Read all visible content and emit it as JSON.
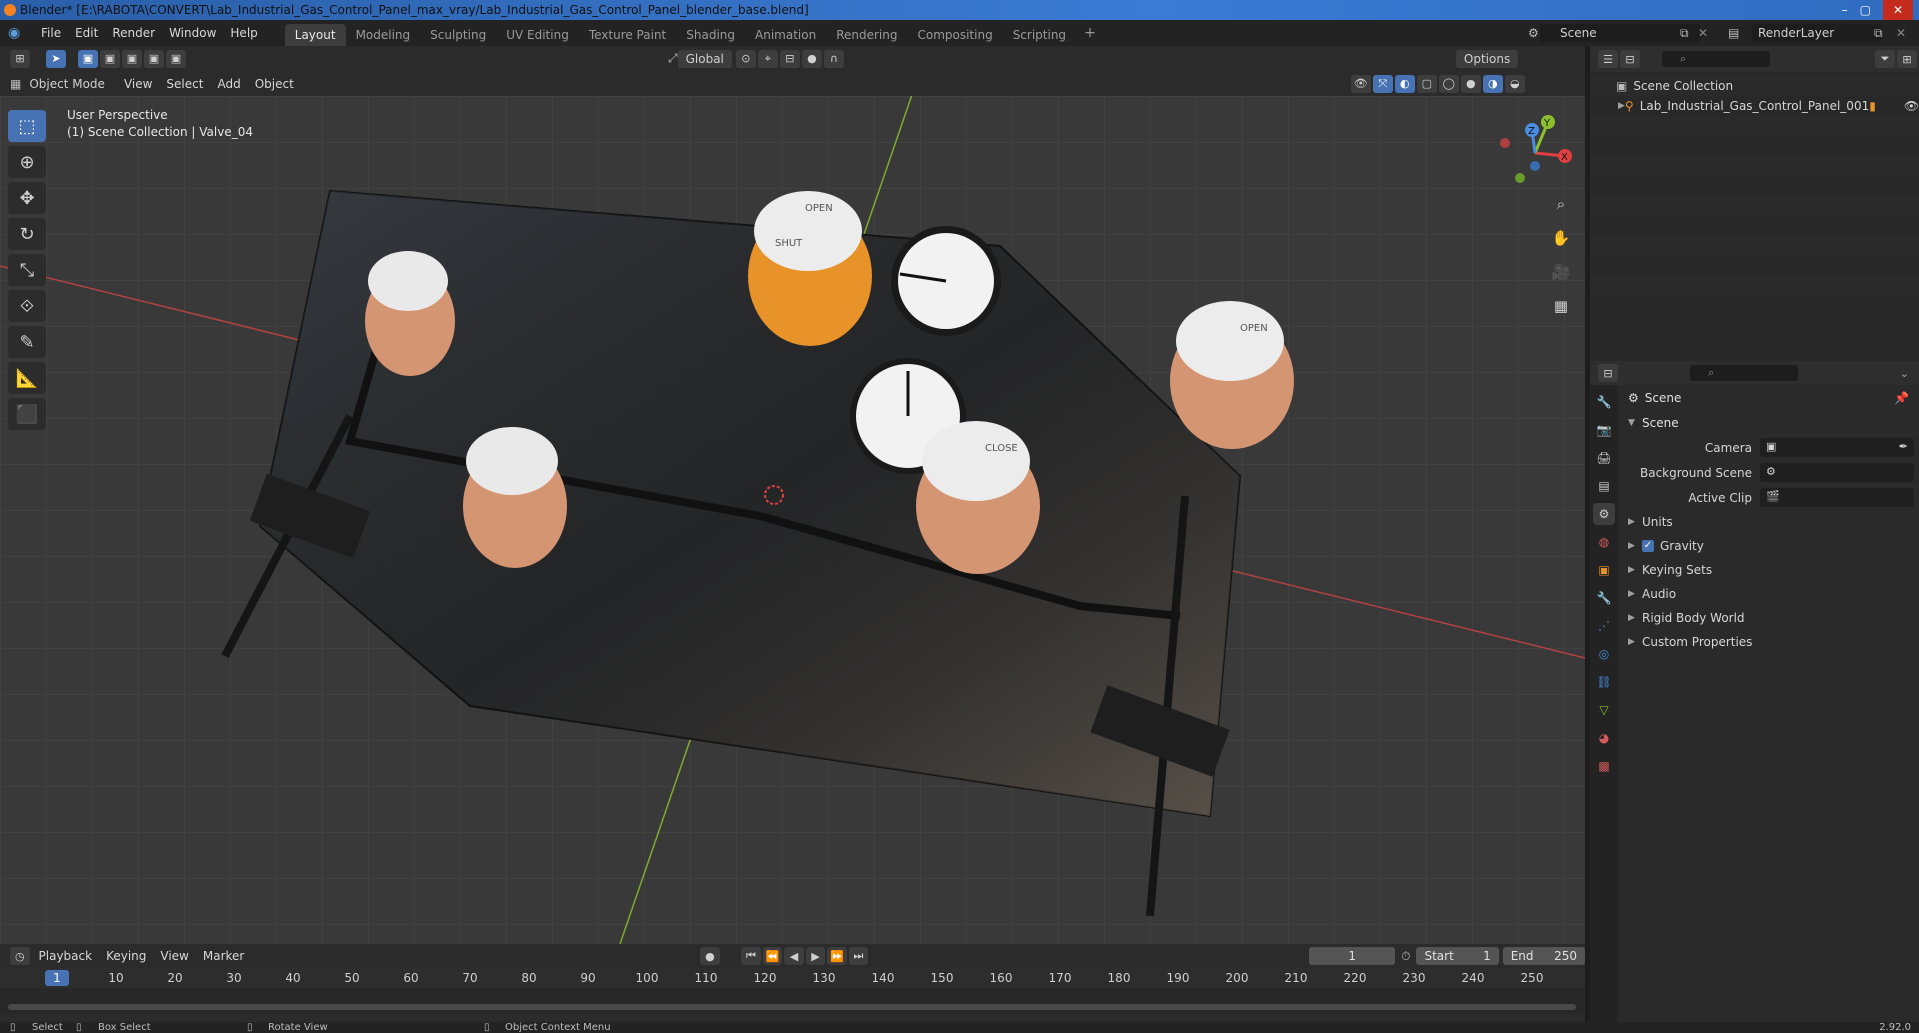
{
  "window": {
    "title": "Blender* [E:\\RABOTA\\CONVERT\\Lab_Industrial_Gas_Control_Panel_max_vray/Lab_Industrial_Gas_Control_Panel_blender_base.blend]",
    "min": "–",
    "max": "▢",
    "close": "✕"
  },
  "menu": [
    "File",
    "Edit",
    "Render",
    "Window",
    "Help"
  ],
  "workspaces": [
    "Layout",
    "Modeling",
    "Sculpting",
    "UV Editing",
    "Texture Paint",
    "Shading",
    "Animation",
    "Rendering",
    "Compositing",
    "Scripting"
  ],
  "workspace_add": "+",
  "scene": {
    "name": "Scene",
    "render_layer": "RenderLayer"
  },
  "viewport_header": {
    "mode": "Object Mode",
    "menus": [
      "View",
      "Select",
      "Add",
      "Object"
    ],
    "orientation": "Global",
    "options": "Options"
  },
  "viewport": {
    "perspective": "User Perspective",
    "collection_info": "(1) Scene Collection | Valve_04",
    "gizmo": {
      "x": "X",
      "y": "Y",
      "z": "Z"
    },
    "gauges": {
      "open": "OPEN",
      "close": "CLOSE",
      "shut": "SHUT"
    }
  },
  "outliner": {
    "root": "Scene Collection",
    "items": [
      "Lab_Industrial_Gas_Control_Panel_001"
    ]
  },
  "properties": {
    "title": "Scene",
    "section": "Scene",
    "fields": [
      {
        "label": "Camera"
      },
      {
        "label": "Background Scene"
      },
      {
        "label": "Active Clip"
      }
    ],
    "subsections": [
      "Units",
      "Gravity",
      "Keying Sets",
      "Audio",
      "Rigid Body World",
      "Custom Properties"
    ]
  },
  "timeline": {
    "menus": [
      "Playback",
      "Keying",
      "View",
      "Marker"
    ],
    "current_frame": "1",
    "start_label": "Start",
    "start": "1",
    "end_label": "End",
    "end": "250",
    "ticks": [
      "1",
      "10",
      "20",
      "30",
      "40",
      "50",
      "60",
      "70",
      "80",
      "90",
      "100",
      "110",
      "120",
      "130",
      "140",
      "150",
      "160",
      "170",
      "180",
      "190",
      "200",
      "210",
      "220",
      "230",
      "240",
      "250"
    ]
  },
  "statusbar": {
    "select": "Select",
    "box_select": "Box Select",
    "rotate_view": "Rotate View",
    "context_menu": "Object Context Menu",
    "version": "2.92.0"
  },
  "colors": {
    "accent": "#4772b3",
    "knob_orange": "#e8922a",
    "knob_peach": "#d49573",
    "axis_red": "#c94444",
    "axis_green": "#8cbf2d"
  }
}
